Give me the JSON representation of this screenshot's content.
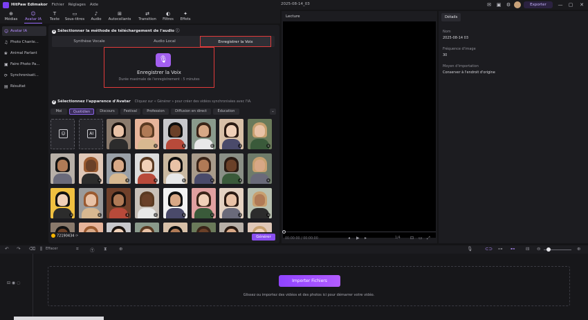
{
  "app": {
    "name": "HitPaw Edimakor",
    "menus": [
      "Fichier",
      "Réglages",
      "Aide"
    ],
    "document_title": "2025-08-14_03",
    "export_label": "Exporter"
  },
  "toolbar": {
    "items": [
      {
        "label": "Médias",
        "icon": "media-icon"
      },
      {
        "label": "Avatar IA",
        "icon": "avatar-icon"
      },
      {
        "label": "Texte",
        "icon": "text-icon"
      },
      {
        "label": "Sous-titres",
        "icon": "subtitle-icon"
      },
      {
        "label": "Audio",
        "icon": "audio-icon"
      },
      {
        "label": "Autocollants",
        "icon": "sticker-icon"
      },
      {
        "label": "Transition",
        "icon": "transition-icon"
      },
      {
        "label": "Filtres",
        "icon": "filter-icon"
      },
      {
        "label": "Effets",
        "icon": "effects-icon"
      }
    ],
    "active": "Avatar IA"
  },
  "sidebar": {
    "items": [
      {
        "label": "Avatar IA"
      },
      {
        "label": "Photo Chante..."
      },
      {
        "label": "Animal Parlant"
      },
      {
        "label": "Faire Photo Pa..."
      },
      {
        "label": "Synchronisati..."
      },
      {
        "label": "Résultat"
      }
    ]
  },
  "step1": {
    "title": "Sélectionner la méthode de téléchargement de l'audio",
    "tabs": [
      "Synthèse Vocale",
      "Audio Local",
      "Enregistrer la Voix"
    ],
    "active_tab": "Enregistrer la Voix",
    "record_label": "Enregistrer la Voix",
    "record_sub": "Durée maximale de l'enregistrement : 5 minutes"
  },
  "step2": {
    "title": "Sélectionnez l'apparence d'Avatar",
    "hint": "Cliquez sur « Générer » pour créer des vidéos synchronisées avec l'IA.",
    "categories": [
      "Moi",
      "Quotidien",
      "Discours",
      "Festival",
      "Profession",
      "Diffusion en direct",
      "Éducation"
    ],
    "active_category": "Quotidien"
  },
  "footer": {
    "credits": "72190434",
    "generate_label": "Générer"
  },
  "preview": {
    "title": "Lecture",
    "timecode": "00:00:00 / 00:00:00",
    "zoom": "1/4"
  },
  "detail": {
    "tab": "Détails",
    "fields": [
      {
        "key": "Nom",
        "value": "2025-08-14 03"
      },
      {
        "key": "Fréquence d'image",
        "value": "30"
      },
      {
        "key": "Moyen d'importation",
        "value": "Conserver à l'endroit d'origine"
      }
    ]
  },
  "timeline": {
    "delete_label": "Effacer",
    "import_label": "Importer Fichiers",
    "drop_text": "Glissez ou importez des vidéos et des photos ici pour démarrer votre vidéo."
  }
}
